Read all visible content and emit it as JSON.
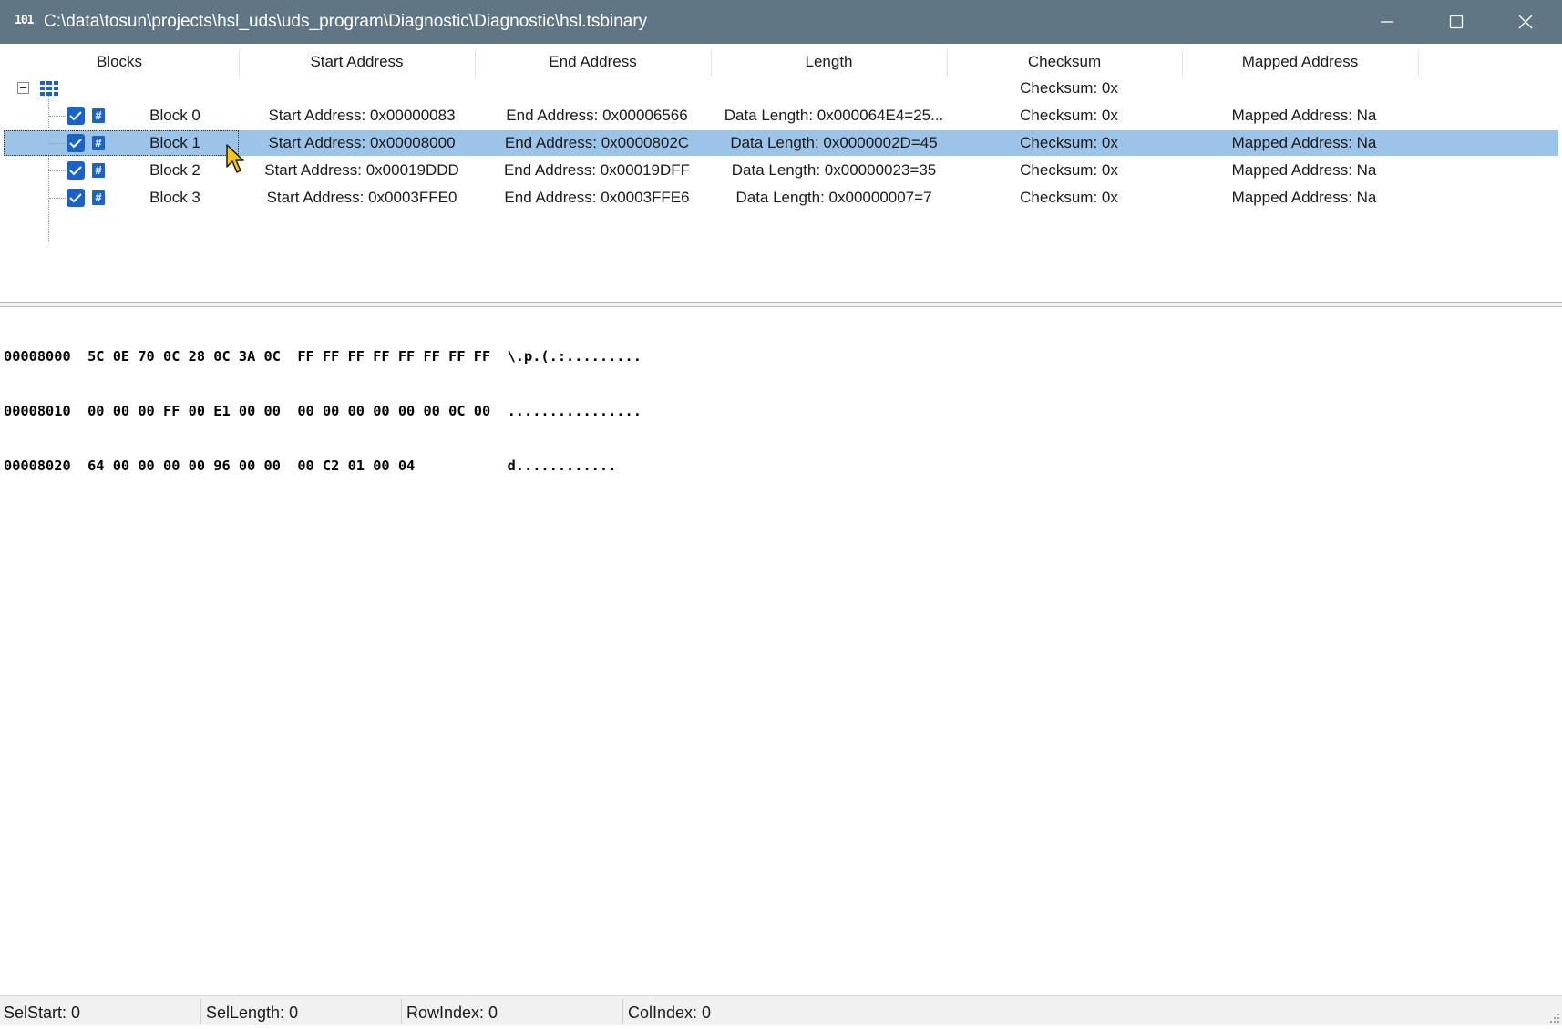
{
  "window": {
    "icon": "binary-icon",
    "icon_text": "101",
    "title": "C:\\data\\tosun\\projects\\hsl_uds\\uds_program\\Diagnostic\\Diagnostic\\hsl.tsbinary"
  },
  "columns": [
    "Blocks",
    "Start Address",
    "End Address",
    "Length",
    "Checksum",
    "Mapped Address"
  ],
  "root": {
    "checksum": "Checksum: 0x"
  },
  "rows": [
    {
      "name": "Block 0",
      "start": "Start Address: 0x00000083",
      "end": "End Address: 0x00006566",
      "length": "Data Length: 0x000064E4=25...",
      "checksum": "Checksum: 0x",
      "mapped": "Mapped Address: Na",
      "checked": true
    },
    {
      "name": "Block 1",
      "start": "Start Address: 0x00008000",
      "end": "End Address: 0x0000802C",
      "length": "Data Length: 0x0000002D=45",
      "checksum": "Checksum: 0x",
      "mapped": "Mapped Address: Na",
      "checked": true,
      "selected": true
    },
    {
      "name": "Block 2",
      "start": "Start Address: 0x00019DDD",
      "end": "End Address: 0x00019DFF",
      "length": "Data Length: 0x00000023=35",
      "checksum": "Checksum: 0x",
      "mapped": "Mapped Address: Na",
      "checked": true
    },
    {
      "name": "Block 3",
      "start": "Start Address: 0x0003FFE0",
      "end": "End Address: 0x0003FFE6",
      "length": "Data Length: 0x00000007=7",
      "checksum": "Checksum: 0x",
      "mapped": "Mapped Address: Na",
      "checked": true
    }
  ],
  "hex": [
    "00008000  5C 0E 70 0C 28 0C 3A 0C  FF FF FF FF FF FF FF FF  \\.p.(.:.........",
    "00008010  00 00 00 FF 00 E1 00 00  00 00 00 00 00 00 0C 00  ................",
    "00008020  64 00 00 00 00 96 00 00  00 C2 01 00 04           d............"
  ],
  "status": {
    "sel_start": "SelStart: 0",
    "sel_length": "SelLength: 0",
    "row_index": "RowIndex: 0",
    "col_index": "ColIndex: 0"
  },
  "colors": {
    "titlebar": "#607684",
    "selection": "#9cc3e8",
    "checkbox": "#1a63c4"
  }
}
